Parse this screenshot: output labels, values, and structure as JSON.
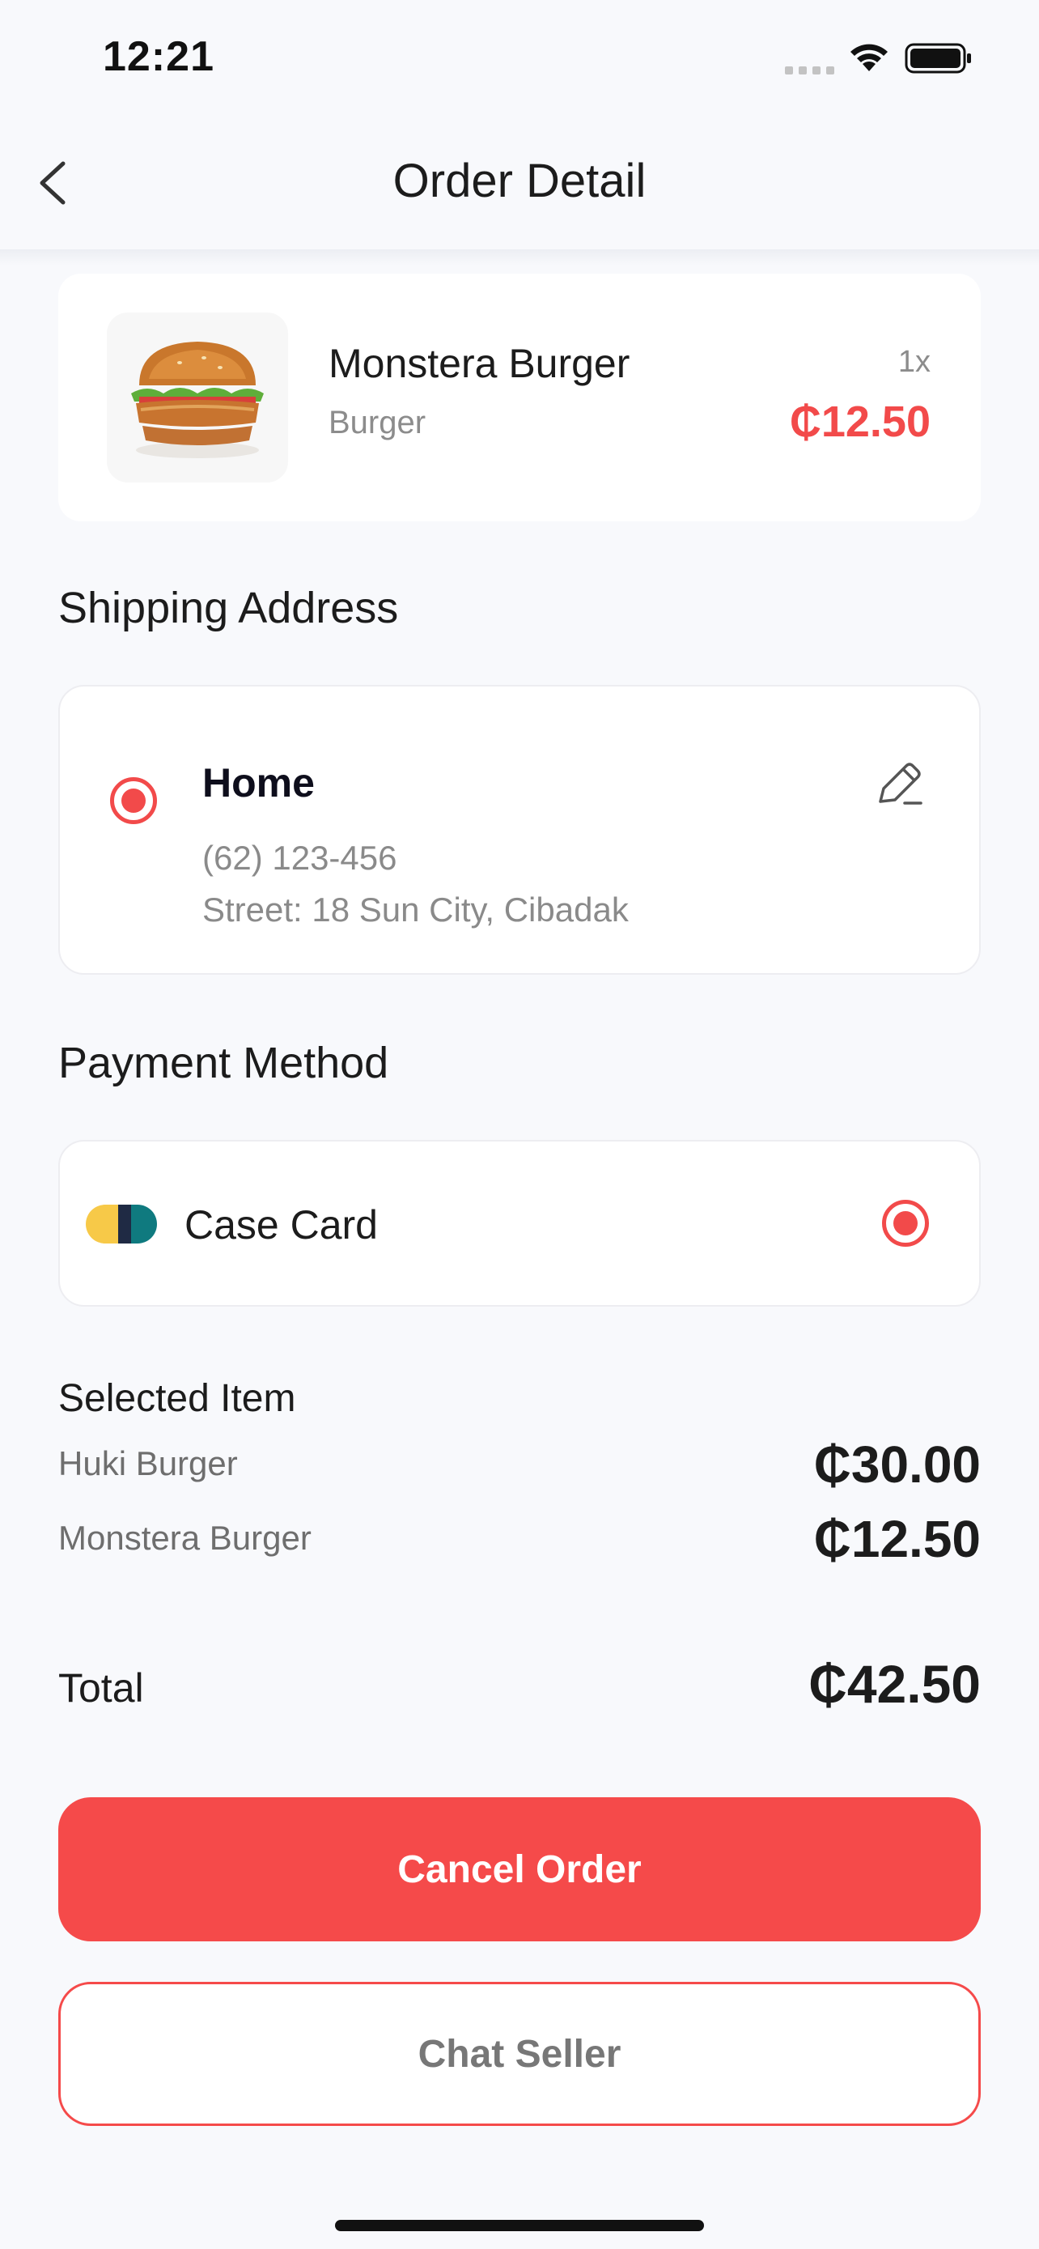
{
  "status_bar": {
    "time": "12:21"
  },
  "header": {
    "title": "Order Detail",
    "back_icon": "chevron-left-icon"
  },
  "product": {
    "name": "Monstera Burger",
    "category": "Burger",
    "quantity": "1x",
    "price": "₵12.50",
    "image": "burger-image"
  },
  "shipping": {
    "section_title": "Shipping Address",
    "label": "Home",
    "phone": "(62) 123-456",
    "street": "Street: 18 Sun City, Cibadak",
    "selected": true
  },
  "payment": {
    "section_title": "Payment Method",
    "method": "Case Card",
    "selected": true
  },
  "summary": {
    "title": "Selected Item",
    "items": [
      {
        "name": "Huki Burger",
        "price": "₵30.00"
      },
      {
        "name": "Monstera Burger",
        "price": "₵12.50"
      }
    ],
    "total_label": "Total",
    "total_value": "₵42.50"
  },
  "actions": {
    "cancel_label": "Cancel Order",
    "chat_label": "Chat Seller"
  },
  "colors": {
    "accent": "#f54a4a",
    "background": "#f8f9fc",
    "card_yellow": "#f7c948",
    "card_navy": "#1f2a44",
    "card_teal": "#0f7a7f"
  }
}
